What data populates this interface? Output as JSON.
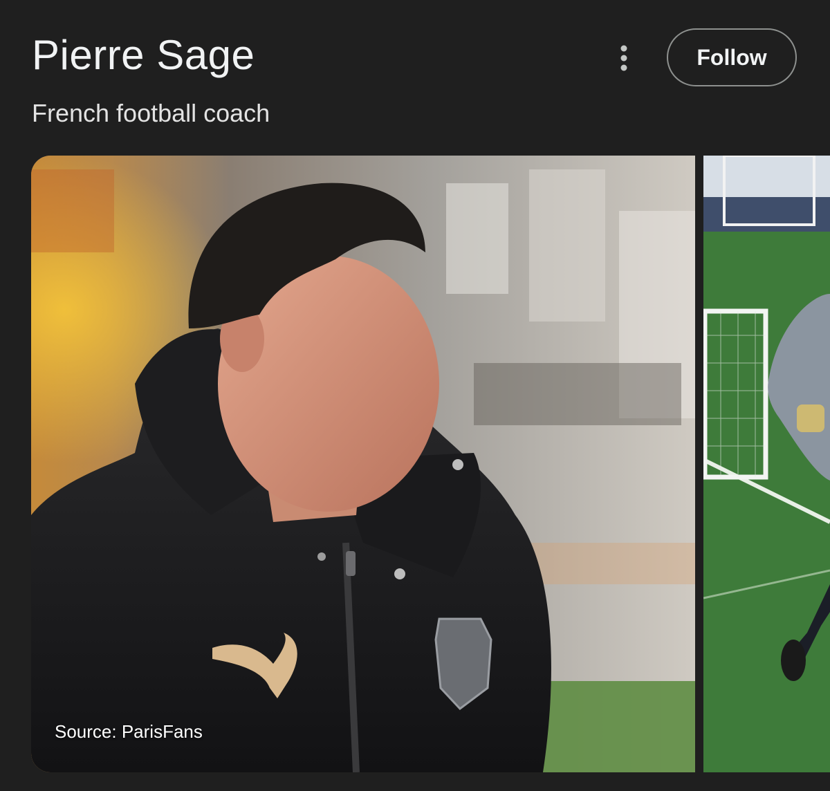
{
  "header": {
    "title": "Pierre Sage",
    "subtitle": "French football coach",
    "follow_label": "Follow"
  },
  "images": [
    {
      "source_label": "Source: ParisFans",
      "description": "Coach in black puffer jacket at stadium"
    },
    {
      "description": "Player training on football pitch next to goal"
    }
  ],
  "icons": {
    "more": "more-vert-icon"
  },
  "colors": {
    "background": "#1f1f1f",
    "title_text": "#f1f3f4",
    "button_border": "#8e918f"
  }
}
